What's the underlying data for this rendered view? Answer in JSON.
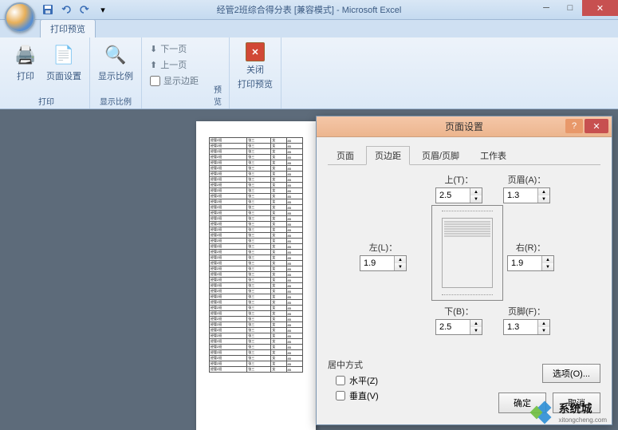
{
  "title": "经管2班综合得分表 [兼容模式] - Microsoft Excel",
  "ribbon_tab": "打印预览",
  "ribbon": {
    "print": "打印",
    "page_setup": "页面设置",
    "zoom": "显示比例",
    "next_page": "下一页",
    "prev_page": "上一页",
    "show_margins": "显示边距",
    "close_preview": "关闭打印预览",
    "close_label": "关闭",
    "group_print": "打印",
    "group_zoom": "显示比例",
    "group_preview": "预览"
  },
  "dialog": {
    "title": "页面设置",
    "tabs": {
      "page": "页面",
      "margins": "页边距",
      "headerfooter": "页眉/页脚",
      "sheet": "工作表"
    },
    "labels": {
      "top": "上(T)：",
      "bottom": "下(B)：",
      "left": "左(L)：",
      "right": "右(R)：",
      "header": "页眉(A)：",
      "footer": "页脚(F)：",
      "center": "居中方式",
      "horiz": "水平(Z)",
      "vert": "垂直(V)",
      "options": "选项(O)...",
      "ok": "确定",
      "cancel": "取消"
    },
    "values": {
      "top": "2.5",
      "bottom": "2.5",
      "left": "1.9",
      "right": "1.9",
      "header": "1.3",
      "footer": "1.3"
    }
  },
  "watermark": {
    "name": "系统城",
    "url": "xitongcheng.com"
  }
}
